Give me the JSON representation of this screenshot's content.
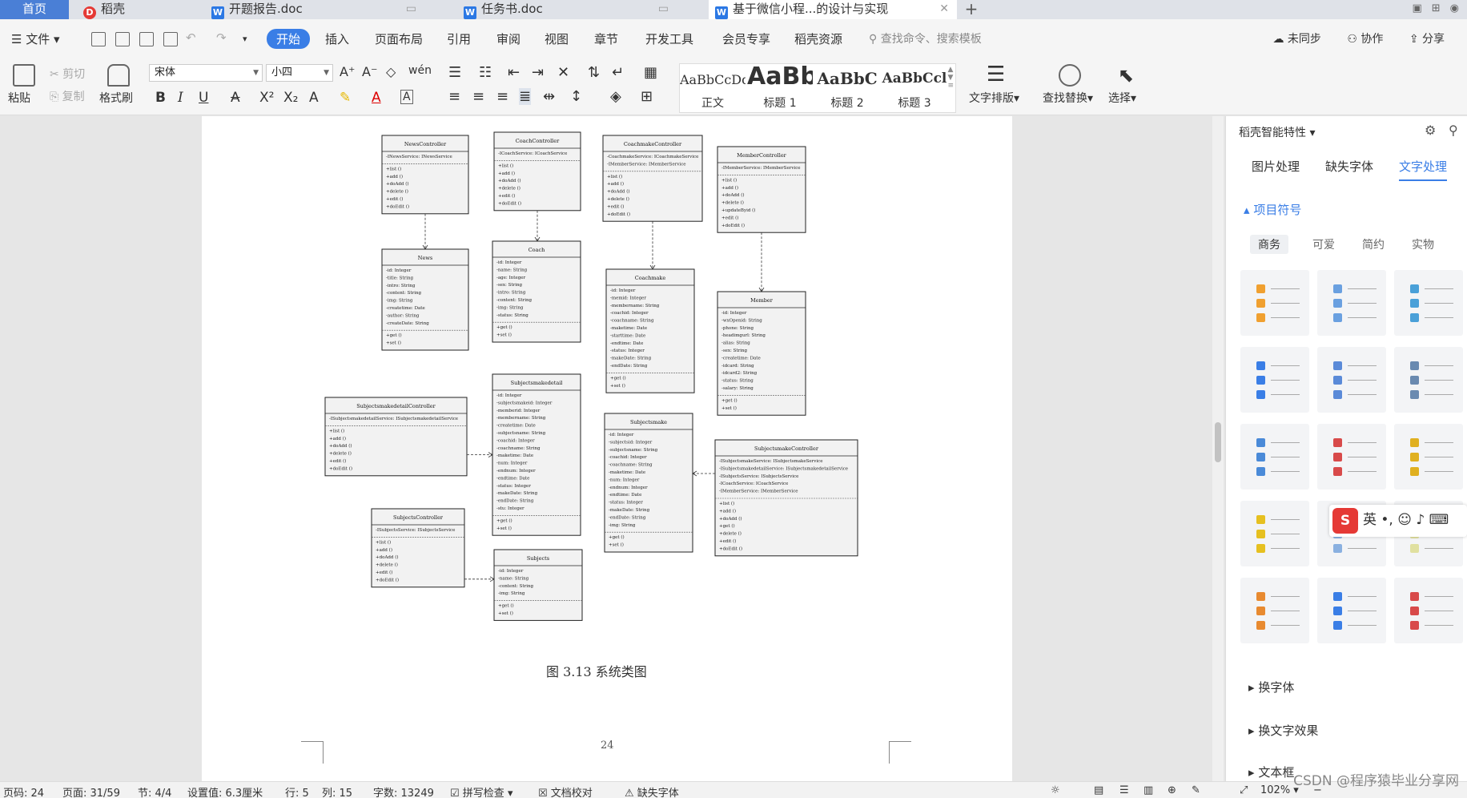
{
  "tabs": {
    "home": "首页",
    "items": [
      {
        "label": "稻壳",
        "icon": "docer-icon"
      },
      {
        "label": "开题报告.doc",
        "icon": "word-icon"
      },
      {
        "label": "任务书.doc",
        "icon": "word-icon"
      },
      {
        "label": "基于微信小程...的设计与实现",
        "icon": "word-icon"
      }
    ],
    "add": "+"
  },
  "menu": {
    "file": "文件",
    "items": [
      "开始",
      "插入",
      "页面布局",
      "引用",
      "审阅",
      "视图",
      "章节",
      "开发工具",
      "会员专享",
      "稻壳资源"
    ],
    "search": "查找命令、搜索模板",
    "sync": "未同步",
    "collab": "协作",
    "share": "分享"
  },
  "toolbar": {
    "paste": "粘贴",
    "cut": "剪切",
    "copy": "复制",
    "format_painter": "格式刷",
    "font": "宋体",
    "size": "小四",
    "styles": [
      {
        "preview": "AaBbCcDd",
        "label": "正文"
      },
      {
        "preview": "AaBb",
        "label": "标题 1"
      },
      {
        "preview": "AaBbC",
        "label": "标题 2"
      },
      {
        "preview": "AaBbCcl",
        "label": "标题 3"
      }
    ],
    "text_layout": "文字排版",
    "find_replace": "查找替换",
    "select": "选择"
  },
  "document": {
    "caption": "图 3.13  系统类图",
    "page_number": "24"
  },
  "classes": [
    {
      "name": "NewsController",
      "attrs": [
        "-INewsService: INewsService"
      ],
      "methods": [
        "+list ()",
        "+add ()",
        "+doAdd ()",
        "+delete ()",
        "+edit ()",
        "+doEdit ()"
      ]
    },
    {
      "name": "CoachController",
      "attrs": [
        "-ICoachService: ICoachService"
      ],
      "methods": [
        "+list ()",
        "+add ()",
        "+doAdd ()",
        "+delete ()",
        "+edit ()",
        "+doEdit ()"
      ]
    },
    {
      "name": "CoachmakeController",
      "attrs": [
        "-CoachmakeService: ICoachmakeService",
        "-IMemberService: IMemberService"
      ],
      "methods": [
        "+list ()",
        "+add ()",
        "+doAdd ()",
        "+delete ()",
        "+edit ()",
        "+doEdit ()"
      ]
    },
    {
      "name": "MemberController",
      "attrs": [
        "-IMemberService: IMemberService"
      ],
      "methods": [
        "+list ()",
        "+add ()",
        "+doAdd ()",
        "+delete ()",
        "+updateByid ()",
        "+edit ()",
        "+doEdit ()"
      ]
    },
    {
      "name": "News",
      "attrs": [
        "-id: Integer",
        "-title: String",
        "-intro: String",
        "-content: String",
        "-img: String",
        "-createtime: Date",
        "-author: String",
        "-createDate: String"
      ],
      "methods": [
        "+get ()",
        "+set ()"
      ]
    },
    {
      "name": "Coach",
      "attrs": [
        "-id: Integer",
        "-name: String",
        "-age: Integer",
        "-sex: String",
        "-intro: String",
        "-content: String",
        "-img: String",
        "-status: String"
      ],
      "methods": [
        "+get ()",
        "+set ()"
      ]
    },
    {
      "name": "Coachmake",
      "attrs": [
        "-id: Integer",
        "-memid: Integer",
        "-membername: String",
        "-coachid: Integer",
        "-coachname: String",
        "-maketime: Date",
        "-starttime: Date",
        "-endtime: Date",
        "-status: Integer",
        "-makeDate: String",
        "-endDate: String"
      ],
      "methods": [
        "+get ()",
        "+set ()"
      ]
    },
    {
      "name": "Member",
      "attrs": [
        "-id: Integer",
        "-wxOpenid: String",
        "-phone: String",
        "-headimgurl: String",
        "-alias: String",
        "-sex: String",
        "-createtime: Date",
        "-idcard: String",
        "-idcard2: String",
        "-status: String",
        "-salary: String"
      ],
      "methods": [
        "+get ()",
        "+set ()"
      ]
    },
    {
      "name": "SubjectsmakedetailController",
      "attrs": [
        "-ISubjectsmakedetailService: ISubjectsmakedetailService"
      ],
      "methods": [
        "+list ()",
        "+add ()",
        "+doAdd ()",
        "+delete ()",
        "+edit ()",
        "+doEdit ()"
      ]
    },
    {
      "name": "Subjectsmakedetail",
      "attrs": [
        "-id: Integer",
        "-subjectsmakeid: Integer",
        "-memberid: Integer",
        "-membername: String",
        "-createtime: Date",
        "-subjectsname: String",
        "-coachid: Integer",
        "-coachname: String",
        "-maketime: Date",
        "-num: Integer",
        "-endnum: Integer",
        "-endtime: Date",
        "-status: Integer",
        "-makeDate: String",
        "-endDate: String",
        "-stu: Integer"
      ],
      "methods": [
        "+get ()",
        "+set ()"
      ]
    },
    {
      "name": "Subjectsmake",
      "attrs": [
        "-id: Integer",
        "-subjectsid: Integer",
        "-subjectsname: String",
        "-coachid: Integer",
        "-coachname: String",
        "-maketime: Date",
        "-num: Integer",
        "-endnum: Integer",
        "-endtime: Date",
        "-status: Integer",
        "-makeDate: String",
        "-endDate: String",
        "-img: String"
      ],
      "methods": [
        "+get ()",
        "+set ()"
      ]
    },
    {
      "name": "SubjectsmakeController",
      "attrs": [
        "-ISubjectsmakeService: ISubjectsmakeService",
        "-ISubjectsmakedetailService: ISubjectsmakedetailService",
        "-ISubjectsService: ISubjectsService",
        "-ICoachService: ICoachService",
        "-IMemberService: IMemberService"
      ],
      "methods": [
        "+list ()",
        "+add ()",
        "+doAdd ()",
        "+get ()",
        "+delete ()",
        "+edit ()",
        "+doEdit ()"
      ]
    },
    {
      "name": "SubjectsController",
      "attrs": [
        "-ISubjectsService: ISubjectsService"
      ],
      "methods": [
        "+list ()",
        "+add ()",
        "+doAdd ()",
        "+delete ()",
        "+edit ()",
        "+doEdit ()"
      ]
    },
    {
      "name": "Subjects",
      "attrs": [
        "-id: Integer",
        "-name: String",
        "-content: String",
        "-img: String"
      ],
      "methods": [
        "+get ()",
        "+set ()"
      ]
    }
  ],
  "panel": {
    "title": "稻壳智能特性",
    "tabs": [
      "图片处理",
      "缺失字体",
      "文字处理"
    ],
    "section": "项目符号",
    "subtabs": [
      "商务",
      "可爱",
      "简约",
      "实物"
    ],
    "links": [
      "换字体",
      "换文字效果",
      "文本框"
    ]
  },
  "status": {
    "page_code": "页码: 24",
    "page": "页面: 31/59",
    "section": "节: 4/4",
    "setting": "设置值: 6.3厘米",
    "row": "行: 5",
    "col": "列: 15",
    "words": "字数: 13249",
    "spell": "拼写检查",
    "proof": "文档校对",
    "missing_font": "缺失字体",
    "zoom": "102%"
  },
  "ime": {
    "label": "英"
  },
  "watermark": "CSDN @程序猿毕业分享网"
}
